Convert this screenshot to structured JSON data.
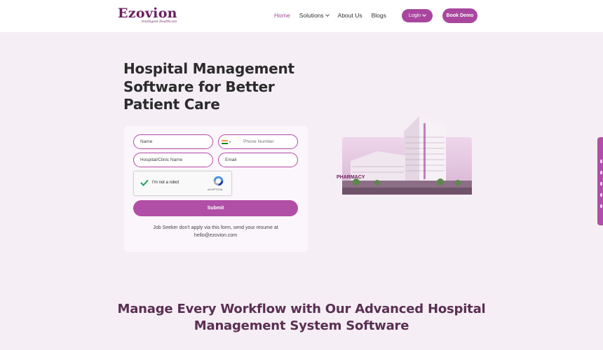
{
  "header": {
    "logo": "Ezovion",
    "tagline": "Intelligent Healthcare",
    "nav": [
      {
        "label": "Home",
        "active": true
      },
      {
        "label": "Solutions",
        "dropdown": true
      },
      {
        "label": "About Us"
      },
      {
        "label": "Blogs"
      }
    ],
    "login_label": "Login",
    "demo_label": "Book Demo"
  },
  "hero": {
    "title": "Hospital Management Software for Better Patient Care"
  },
  "form": {
    "name_placeholder": "Name",
    "phone_placeholder": "Phone Number",
    "hospital_placeholder": "Hospital/Clinic Name",
    "email_placeholder": "Email",
    "captcha_label": "I'm not a robot",
    "captcha_brand": "reCAPTCHA",
    "submit_label": "Submit",
    "note": "Job Seeker don't apply via this form, send your resume at hello@ezovion.com"
  },
  "illustration": {
    "sign": "PHARMACY"
  },
  "section": {
    "title": "Manage Every Workflow with Our Advanced Hospital Management System Software"
  },
  "colors": {
    "accent": "#b14ea6",
    "brand": "#6b1f5e",
    "background": "#f5eef5"
  }
}
